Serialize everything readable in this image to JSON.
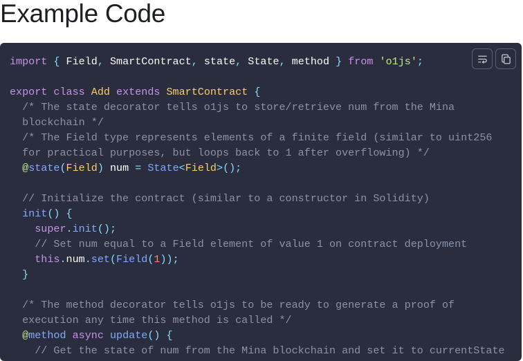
{
  "page": {
    "heading": "Example Code"
  },
  "code_block": {
    "language": "typescript",
    "buttons": [
      {
        "name": "word-wrap-toggle-button",
        "icon": "word-wrap-icon"
      },
      {
        "name": "copy-button",
        "icon": "copy-icon"
      }
    ],
    "lines": [
      [
        [
          "kw",
          "import"
        ],
        [
          "plain",
          " "
        ],
        [
          "punc",
          "{"
        ],
        [
          "plain",
          " "
        ],
        [
          "ident",
          "Field"
        ],
        [
          "punc",
          ","
        ],
        [
          "plain",
          " "
        ],
        [
          "ident",
          "SmartContract"
        ],
        [
          "punc",
          ","
        ],
        [
          "plain",
          " "
        ],
        [
          "ident",
          "state"
        ],
        [
          "punc",
          ","
        ],
        [
          "plain",
          " "
        ],
        [
          "ident",
          "State"
        ],
        [
          "punc",
          ","
        ],
        [
          "plain",
          " "
        ],
        [
          "ident",
          "method"
        ],
        [
          "plain",
          " "
        ],
        [
          "punc",
          "}"
        ],
        [
          "plain",
          " "
        ],
        [
          "kw",
          "from"
        ],
        [
          "plain",
          " "
        ],
        [
          "str",
          "'o1js'"
        ],
        [
          "punc",
          ";"
        ]
      ],
      [],
      [
        [
          "kw",
          "export"
        ],
        [
          "plain",
          " "
        ],
        [
          "kw",
          "class"
        ],
        [
          "plain",
          " "
        ],
        [
          "cls",
          "Add"
        ],
        [
          "plain",
          " "
        ],
        [
          "kw",
          "extends"
        ],
        [
          "plain",
          " "
        ],
        [
          "cls",
          "SmartContract"
        ],
        [
          "plain",
          " "
        ],
        [
          "punc",
          "{"
        ]
      ],
      [
        [
          "plain",
          "  "
        ],
        [
          "cmt",
          "/* The state decorator tells o1js to store/retrieve num from the Mina"
        ]
      ],
      [
        [
          "plain",
          "  "
        ],
        [
          "cmt",
          "blockchain */"
        ]
      ],
      [
        [
          "plain",
          "  "
        ],
        [
          "cmt",
          "/* The Field type represents elements of a finite field (similar to uint256"
        ]
      ],
      [
        [
          "plain",
          "  "
        ],
        [
          "cmt",
          "for practical purposes, but loops back to 1 after overflowing) */"
        ]
      ],
      [
        [
          "plain",
          "  "
        ],
        [
          "dec",
          "@"
        ],
        [
          "fn",
          "state"
        ],
        [
          "punc",
          "("
        ],
        [
          "cls",
          "Field"
        ],
        [
          "punc",
          ")"
        ],
        [
          "plain",
          " "
        ],
        [
          "ident",
          "num"
        ],
        [
          "plain",
          " "
        ],
        [
          "punc",
          "="
        ],
        [
          "plain",
          " "
        ],
        [
          "fn",
          "State"
        ],
        [
          "punc",
          "<"
        ],
        [
          "cls",
          "Field"
        ],
        [
          "punc",
          ">"
        ],
        [
          "punc",
          "();"
        ]
      ],
      [],
      [
        [
          "plain",
          "  "
        ],
        [
          "cmt",
          "// Initialize the contract (similar to a constructor in Solidity)"
        ]
      ],
      [
        [
          "plain",
          "  "
        ],
        [
          "fn",
          "init"
        ],
        [
          "punc",
          "()"
        ],
        [
          "plain",
          " "
        ],
        [
          "punc",
          "{"
        ]
      ],
      [
        [
          "plain",
          "    "
        ],
        [
          "kw",
          "super"
        ],
        [
          "punc",
          "."
        ],
        [
          "fn",
          "init"
        ],
        [
          "punc",
          "();"
        ]
      ],
      [
        [
          "plain",
          "    "
        ],
        [
          "cmt",
          "// Set num equal to a Field element of value 1 on contract deployment"
        ]
      ],
      [
        [
          "plain",
          "    "
        ],
        [
          "kw",
          "this"
        ],
        [
          "punc",
          "."
        ],
        [
          "ident",
          "num"
        ],
        [
          "punc",
          "."
        ],
        [
          "fn",
          "set"
        ],
        [
          "punc",
          "("
        ],
        [
          "fn",
          "Field"
        ],
        [
          "punc",
          "("
        ],
        [
          "num",
          "1"
        ],
        [
          "punc",
          "));"
        ]
      ],
      [
        [
          "plain",
          "  "
        ],
        [
          "punc",
          "}"
        ]
      ],
      [],
      [
        [
          "plain",
          "  "
        ],
        [
          "cmt",
          "/* The method decorator tells o1js to be ready to generate a proof of"
        ]
      ],
      [
        [
          "plain",
          "  "
        ],
        [
          "cmt",
          "execution any time this method is called */"
        ]
      ],
      [
        [
          "plain",
          "  "
        ],
        [
          "dec",
          "@"
        ],
        [
          "fn",
          "method"
        ],
        [
          "plain",
          " "
        ],
        [
          "kw",
          "async"
        ],
        [
          "plain",
          " "
        ],
        [
          "fn",
          "update"
        ],
        [
          "punc",
          "()"
        ],
        [
          "plain",
          " "
        ],
        [
          "punc",
          "{"
        ]
      ],
      [
        [
          "plain",
          "    "
        ],
        [
          "cmt",
          "// Get the state of num from the Mina blockchain and set it to currentState"
        ]
      ]
    ]
  }
}
